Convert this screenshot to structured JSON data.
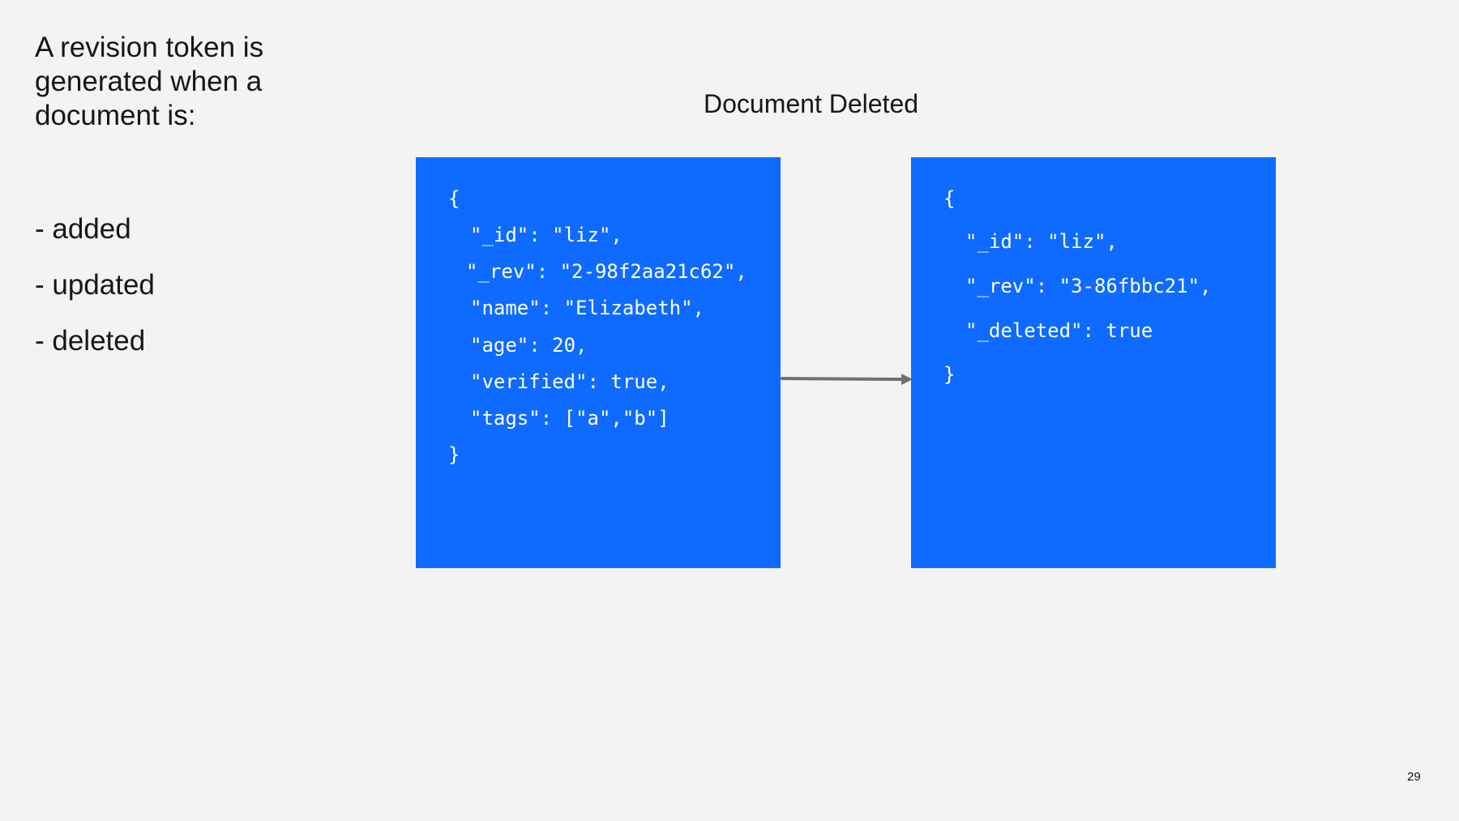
{
  "intro": {
    "heading": "A revision token is generated when a document is:",
    "bullets": [
      "- added",
      "- updated",
      "- deleted"
    ]
  },
  "slide_title": "Document Deleted",
  "before_doc": {
    "lines": [
      "{",
      "\"_id\": \"liz\",",
      "\"_rev\": \"2-98f2aa21c62\",",
      "\"name\": \"Elizabeth\",",
      "\"age\": 20,",
      "\"verified\": true,",
      "\"tags\": [\"a\",\"b\"]",
      "}"
    ]
  },
  "after_doc": {
    "lines": [
      "{",
      "\"_id\": \"liz\",",
      "\"_rev\": \"3-86fbbc21\",",
      "\"_deleted\": true",
      "}"
    ]
  },
  "page_number": "29",
  "colors": {
    "background": "#f3f3f3",
    "code_box": "#0f6bff",
    "arrow": "#707070"
  }
}
